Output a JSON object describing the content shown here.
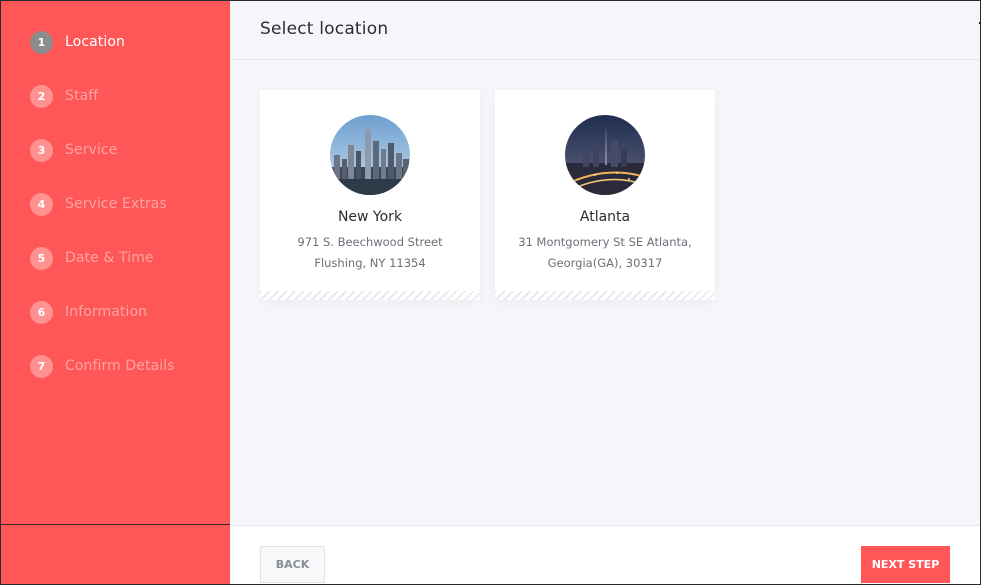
{
  "sidebar": {
    "steps": [
      {
        "number": "1",
        "label": "Location",
        "active": true
      },
      {
        "number": "2",
        "label": "Staff"
      },
      {
        "number": "3",
        "label": "Service"
      },
      {
        "number": "4",
        "label": "Service Extras"
      },
      {
        "number": "5",
        "label": "Date & Time"
      },
      {
        "number": "6",
        "label": "Information"
      },
      {
        "number": "7",
        "label": "Confirm Details"
      }
    ]
  },
  "header": {
    "title": "Select location"
  },
  "locations": [
    {
      "name": "New York",
      "address_line1": "971 S. Beechwood Street",
      "address_line2": "Flushing, NY 11354",
      "image": "new-york-skyline-photo"
    },
    {
      "name": "Atlanta",
      "address_line1": "31 Montgomery St SE Atlanta,",
      "address_line2": "Georgia(GA), 30317",
      "image": "atlanta-city-night-photo"
    }
  ],
  "footer": {
    "back_label": "BACK",
    "next_label": "NEXT STEP"
  },
  "colors": {
    "accent": "#ff5757",
    "background": "#f5f6fa"
  }
}
